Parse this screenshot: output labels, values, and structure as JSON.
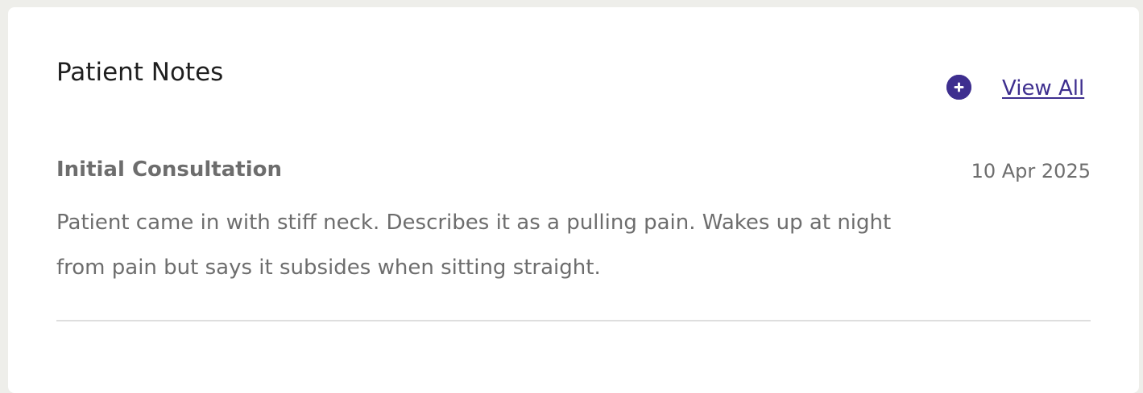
{
  "card": {
    "title": "Patient Notes",
    "view_all_label": "View All",
    "add_icon": "plus-circle-icon"
  },
  "notes": [
    {
      "title": "Initial Consultation",
      "date": "10 Apr 2025",
      "body": "Patient came in with stiff neck. Describes it as a pulling pain. Wakes up at night from pain but says it subsides when sitting straight."
    }
  ],
  "colors": {
    "accent": "#3e2f8f",
    "text_primary": "#1f1f1f",
    "text_secondary": "#6d6d6d",
    "divider": "#dedede",
    "page_background": "#eeeeea",
    "card_background": "#ffffff"
  }
}
